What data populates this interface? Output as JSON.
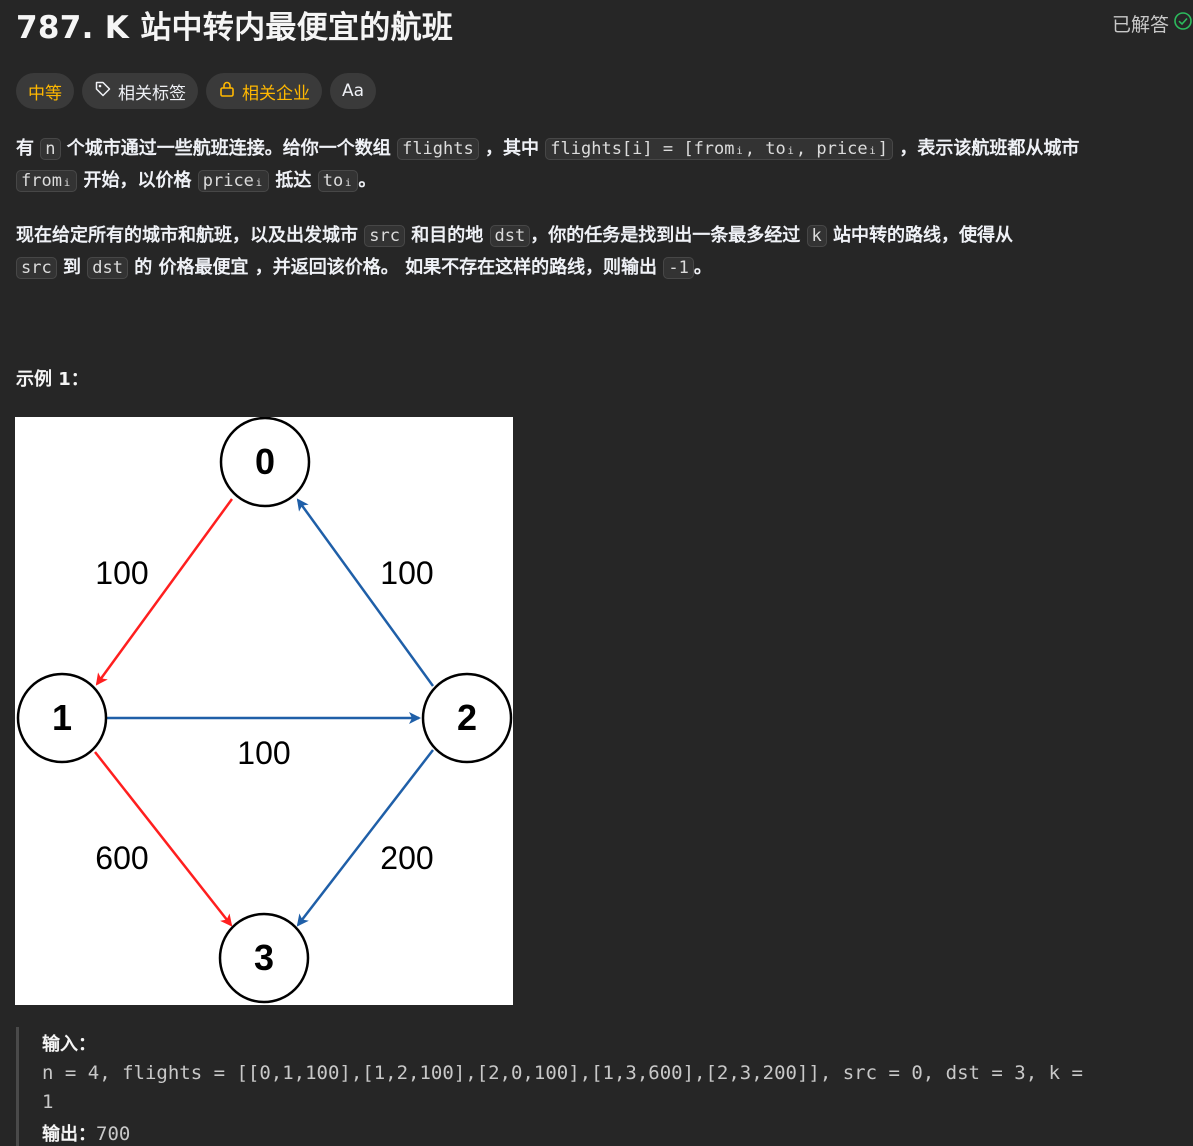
{
  "problem": {
    "title": "787. K 站中转内最便宜的航班",
    "status": "已解答"
  },
  "tags": {
    "difficulty": "中等",
    "topics": "相关标签",
    "companies": "相关企业",
    "font_toggle": "Aa"
  },
  "description": {
    "p1": {
      "t1": "有 ",
      "c_n": "n",
      "t2": " 个城市通过一些航班连接。给你一个数组 ",
      "c_flights": "flights",
      "t3": " ，其中 ",
      "c_flights_i": "flights[i] = [fromᵢ, toᵢ, priceᵢ]",
      "t4": " ，表示该航班都从城市",
      "c_from": "fromᵢ",
      "t5": " 开始，以价格 ",
      "c_price": "priceᵢ",
      "t6": " 抵达 ",
      "c_to": "toᵢ",
      "t7": "。"
    },
    "p2": {
      "t1": "现在给定所有的城市和航班，以及出发城市 ",
      "c_src": "src",
      "t2": " 和目的地 ",
      "c_dst": "dst",
      "t3": "，你的任务是找到出一条最多经过 ",
      "c_k": "k",
      "t4": " 站中转的路线，使得从",
      "c_src2": "src",
      "t5": " 到 ",
      "c_dst2": "dst",
      "t6": " 的 ",
      "t_bold": "价格最便宜",
      "t7": " ，并返回该价格。 如果不存在这样的路线，则输出 ",
      "c_neg": "-1",
      "t8": "。"
    }
  },
  "example": {
    "title": "示例 1：",
    "graph": {
      "nodes": [
        "0",
        "1",
        "2",
        "3"
      ],
      "edge_labels": {
        "e01": "100",
        "e20": "100",
        "e12": "100",
        "e13": "600",
        "e23": "200"
      },
      "colors": {
        "red_edge": "#ff1f1f",
        "blue_edge": "#1f5fa8"
      }
    },
    "input_label": "输入：",
    "input_value_line1": "n = 4, flights = [[0,1,100],[1,2,100],[2,0,100],[1,3,600],[2,3,200]], src = 0, dst = 3, k =",
    "input_value_line2": "1",
    "output_label": "输出：",
    "output_value": "700"
  }
}
